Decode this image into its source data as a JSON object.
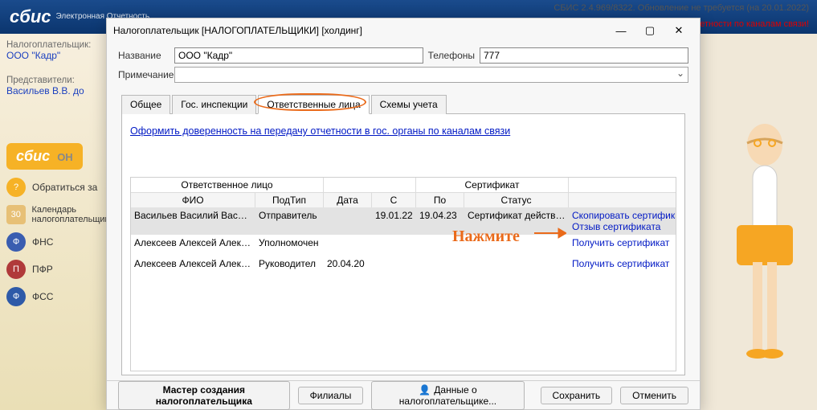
{
  "topbar": {
    "logo": "сбис",
    "logo_sub": "Электронная\nОтчетность",
    "version": "СБИС 2.4.969/8322. Обновление не требуется (на 20.01.2022)",
    "warn": "етности по каналам связи!"
  },
  "sidebar": {
    "payer_label": "Налогоплательщик:",
    "payer_name": "ООО \"Кадр\"",
    "reps_label": "Представители:",
    "reps_name": "Васильев В.В. до",
    "logo2": "сбис",
    "logo2_sub": "ОН",
    "contact": "Обратиться за",
    "calendar": "Календарь налогоплательщика",
    "items": [
      {
        "icon": "Ф",
        "label": "ФНС"
      },
      {
        "icon": "П",
        "label": "ПФР"
      },
      {
        "icon": "Ф",
        "label": "ФСС"
      }
    ]
  },
  "modal": {
    "title": "Налогоплательщик [НАЛОГОПЛАТЕЛЬЩИКИ] [холдинг]",
    "name_label": "Название",
    "name_value": "ООО \"Кадр\"",
    "phone_label": "Телефоны",
    "phone_value": "777",
    "note_label": "Примечание",
    "note_value": "",
    "tabs": {
      "t0": "Общее",
      "t1": "Гос. инспекции",
      "t2": "Ответственные лица",
      "t3": "Схемы учета"
    },
    "link": "Оформить доверенность на передачу отчетности в гос. органы по каналам связи",
    "grid": {
      "groups": {
        "person": "Ответственное лицо",
        "cert": "Сертификат",
        "actions": ""
      },
      "cols": {
        "fio": "ФИО",
        "type": "ПодТип",
        "date": "Дата",
        "from": "С",
        "to": "По",
        "status": "Статус"
      },
      "rows": [
        {
          "fio": "Васильев Василий Василье",
          "type": "Отправитель",
          "date": "",
          "from": "19.01.22",
          "to": "19.04.23",
          "status": "Сертификат действителен.",
          "links": [
            "Скопировать сертификат",
            "Отзыв сертификата"
          ]
        },
        {
          "fio": "Алексеев Алексей Алексее",
          "type": "Уполномочен",
          "date": "",
          "from": "",
          "to": "",
          "status": "",
          "links": [
            "Получить сертификат"
          ]
        },
        {
          "fio": "Алексеев Алексей Алексее",
          "type": "Руководител",
          "date": "20.04.20",
          "from": "",
          "to": "",
          "status": "",
          "links": [
            "Получить сертификат"
          ]
        }
      ]
    },
    "footer": {
      "wizard": "Мастер создания налогоплательщика",
      "branches": "Филиалы",
      "data": "Данные о налогоплательщике...",
      "save": "Сохранить",
      "cancel": "Отменить"
    },
    "annot": "Нажмите"
  }
}
